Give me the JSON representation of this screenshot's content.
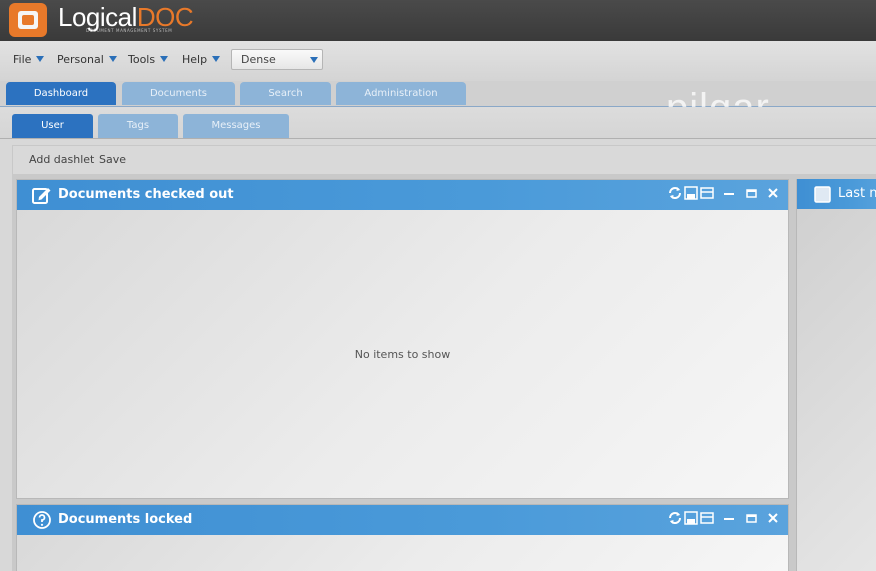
{
  "brand": {
    "name_main": "Logical",
    "name_accent": "DOC",
    "tagline": "DOCUMENT MANAGEMENT SYSTEM",
    "accent_color": "#e8792a"
  },
  "menu": {
    "items": [
      {
        "label": "File"
      },
      {
        "label": "Personal"
      },
      {
        "label": "Tools"
      },
      {
        "label": "Help"
      }
    ],
    "theme_value": "Dense"
  },
  "main_tabs": [
    {
      "label": "Dashboard",
      "active": true
    },
    {
      "label": "Documents",
      "active": false
    },
    {
      "label": "Search",
      "active": false
    },
    {
      "label": "Administration",
      "active": false
    }
  ],
  "watermark": "pilqar",
  "sub_tabs": [
    {
      "label": "User",
      "active": true
    },
    {
      "label": "Tags",
      "active": false
    },
    {
      "label": "Messages",
      "active": false
    }
  ],
  "toolbar": {
    "add_dashlet": "Add dashlet",
    "save": "Save"
  },
  "dashlets": [
    {
      "title": "Documents checked out",
      "icon": "edit-icon",
      "empty_text": "No items to show"
    },
    {
      "title": "Documents locked",
      "icon": "help-icon",
      "empty_text": ""
    },
    {
      "title": "Last n",
      "icon": "document-icon"
    }
  ]
}
